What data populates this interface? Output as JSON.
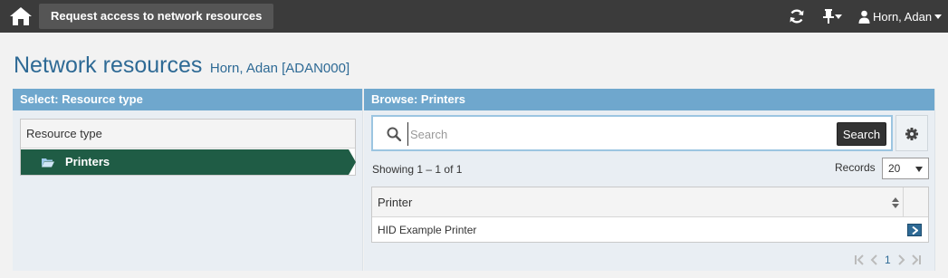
{
  "topbar": {
    "home_icon": "home-icon",
    "tab_label": "Request access to network resources",
    "refresh_icon": "refresh-icon",
    "pin_icon": "pin-icon",
    "user_icon": "user-icon",
    "user_name": "Horn, Adan"
  },
  "heading": {
    "title": "Network resources",
    "subtitle": "Horn, Adan [ADAN000]"
  },
  "left_panel": {
    "header": "Select: Resource type",
    "column_header": "Resource type",
    "items": [
      {
        "label": "Printers",
        "icon": "folder-open-icon",
        "selected": true
      }
    ]
  },
  "right_panel": {
    "header": "Browse: Printers",
    "search": {
      "placeholder": "Search",
      "value": "",
      "button_label": "Search"
    },
    "settings_icon": "gear-icon",
    "showing_text": "Showing 1 – 1 of 1",
    "records_label": "Records",
    "records_value": "20",
    "table": {
      "columns": [
        "Printer"
      ],
      "rows": [
        [
          "HID Example Printer"
        ]
      ]
    },
    "pager": {
      "page": "1"
    }
  },
  "colors": {
    "topbar": "#3b3b3b",
    "panel_header": "#6fa7cd",
    "selected_item": "#1f5c45",
    "title": "#2e6a95"
  }
}
